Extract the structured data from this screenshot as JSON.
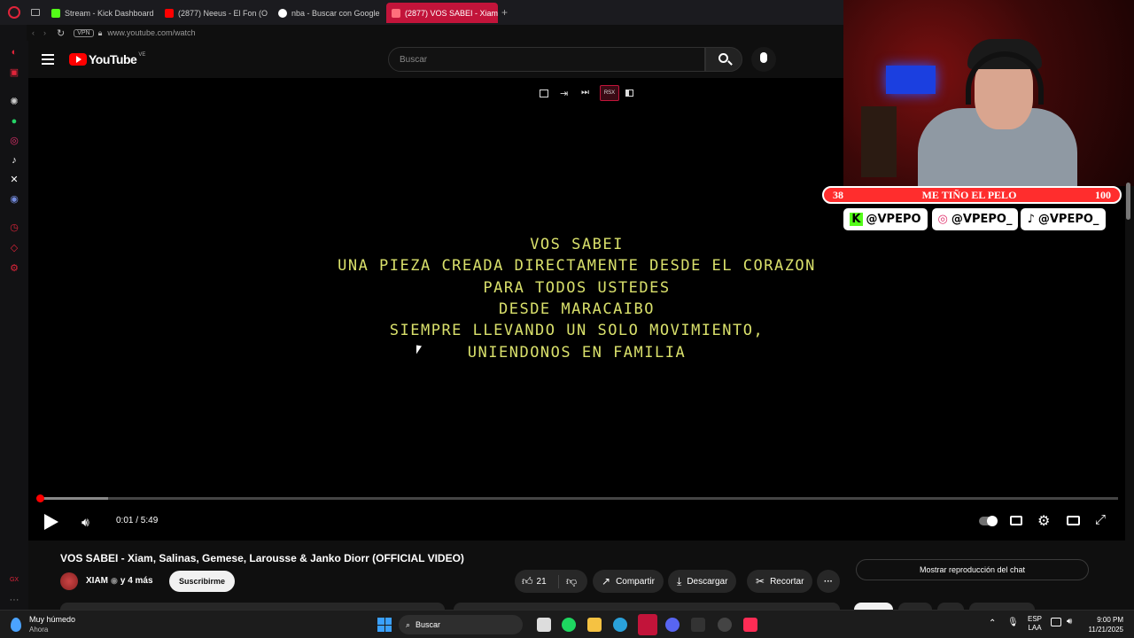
{
  "tabs": [
    {
      "label": "Stream - Kick Dashboard",
      "color": "#53fc18"
    },
    {
      "label": "(2877) Neeus - El Fon (O",
      "color": "#ff0000"
    },
    {
      "label": "nba - Buscar con Google",
      "color": "#ffffff"
    },
    {
      "label": "(2877) VOS SABEI - Xiam",
      "color": "#ff0000"
    }
  ],
  "tab_plus": "+",
  "address": {
    "vpn": "VPN",
    "url": "www.youtube.com/watch"
  },
  "youtube": {
    "logo": "YouTube",
    "country": "VE",
    "search_placeholder": "Buscar"
  },
  "overlay_ctrls": {
    "rsx": "RSX"
  },
  "lyrics": [
    "VOS SABEI",
    "UNA PIEZA CREADA DIRECTAMENTE DESDE EL CORAZON",
    "PARA TODOS USTEDES",
    "DESDE MARACAIBO",
    "SIEMPRE LLEVANDO UN SOLO MOVIMIENTO,",
    "UNIENDONOS EN FAMILIA"
  ],
  "player": {
    "time": "0:01 / 5:49",
    "progress": 0.0028
  },
  "stream_banner": {
    "left": "38",
    "title": "ME TIÑO EL PELO",
    "right": "100"
  },
  "socials": [
    {
      "icon": "K",
      "handle": "@VPEPO"
    },
    {
      "icon": "◎",
      "handle": "@VPEPO_"
    },
    {
      "icon": "♪",
      "handle": "@VPEPO_"
    }
  ],
  "video_info": {
    "title": "VOS SABEI - Xiam, Salinas, Gemese, Larousse & Janko Diorr (OFFICIAL VIDEO)",
    "channel": "XIAM",
    "age": "y 4 más",
    "subscribe": "Suscribirme",
    "likes": "21",
    "share": "Compartir",
    "download": "Descargar",
    "clip": "Recortar",
    "more": "···",
    "chat_replay": "Mostrar reproducción del chat"
  },
  "taskbar": {
    "weather_title": "Muy húmedo",
    "weather_sub": "Ahora",
    "search": "Buscar",
    "lang": "ESP",
    "lang2": "LAA",
    "time": "9:00 PM",
    "date": "11/21/2025"
  }
}
